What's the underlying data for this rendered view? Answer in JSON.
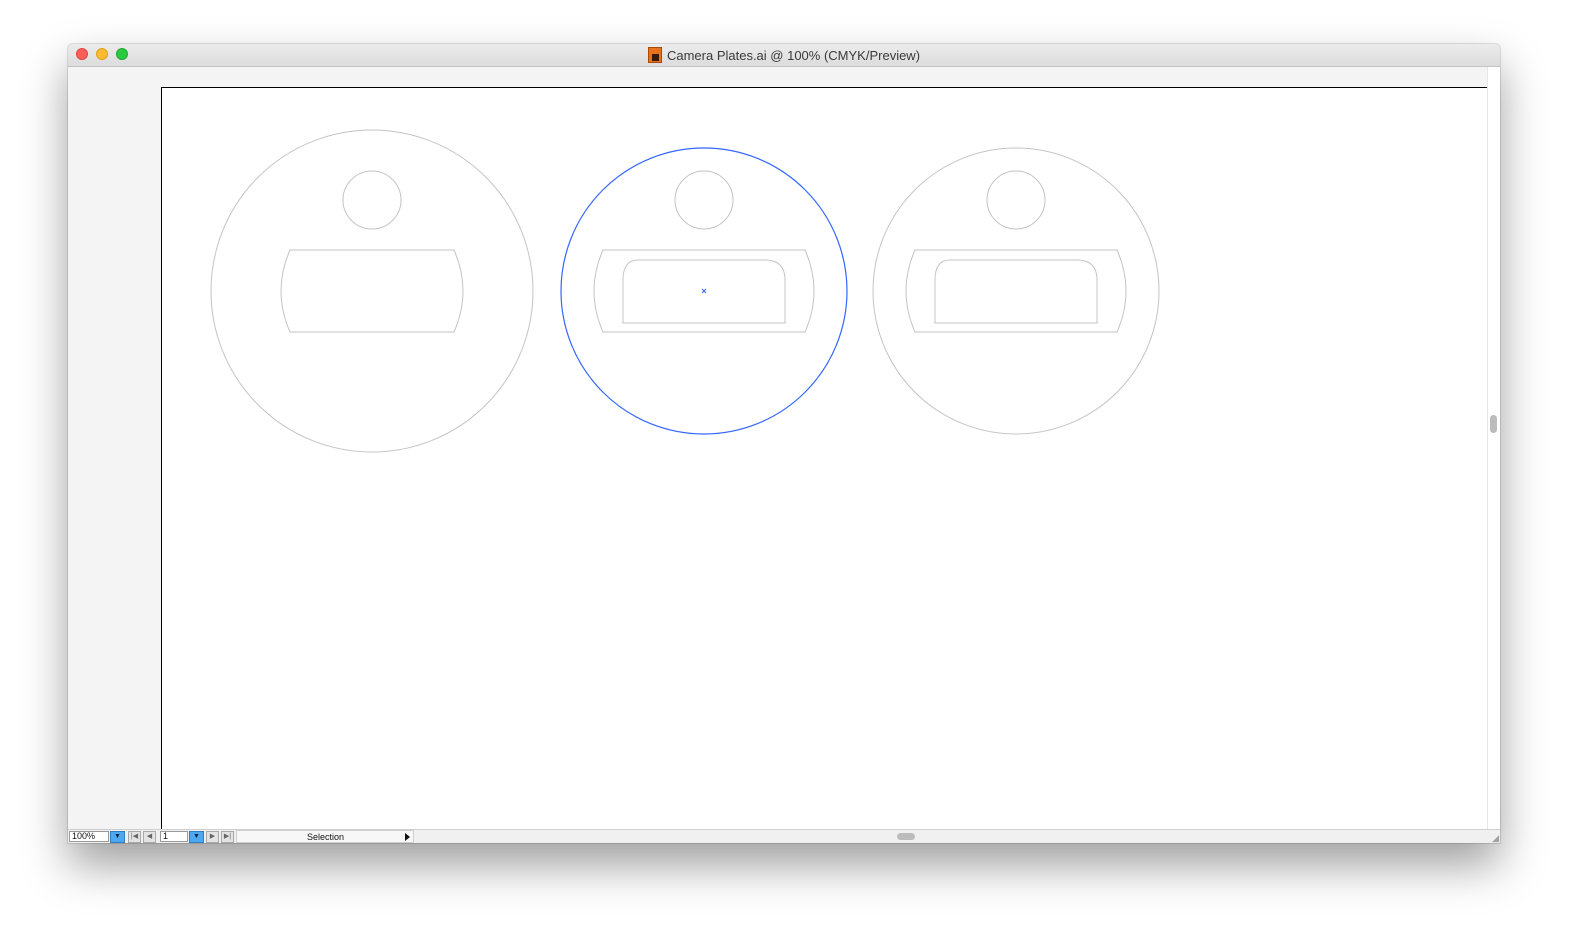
{
  "window": {
    "title": "Camera Plates.ai @ 100% (CMYK/Preview)",
    "document_icon": "illustrator-file-icon"
  },
  "statusbar": {
    "zoom": "100%",
    "page": "1",
    "status": "Selection",
    "dropdown_icon": "triangle-down-icon",
    "first_icon": "first-page-icon",
    "prev_icon": "prev-page-icon",
    "next_icon": "next-page-icon",
    "last_icon": "last-page-icon"
  },
  "artwork": {
    "stroke_color": "#c4c4c4",
    "selection_color": "#3366ff",
    "plates": [
      {
        "selected": false
      },
      {
        "selected": true
      },
      {
        "selected": false
      }
    ]
  }
}
